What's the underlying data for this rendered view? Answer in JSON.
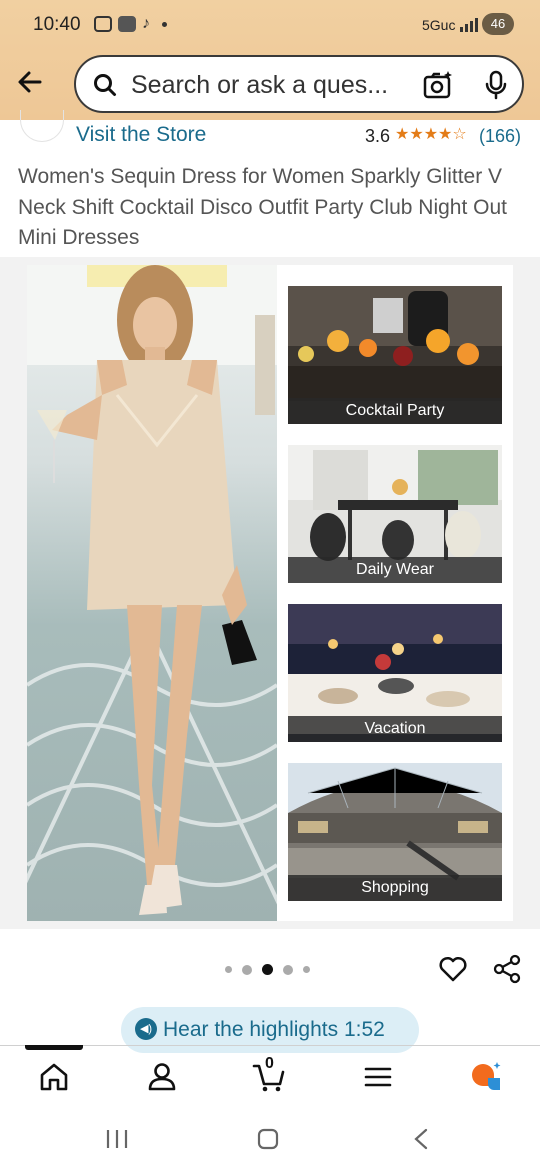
{
  "status_bar": {
    "time": "10:40",
    "network": "5Guc",
    "battery": "46",
    "icons": [
      "screenshot-icon",
      "ring-app-icon",
      "tiktok-icon",
      "notification-dot"
    ]
  },
  "header": {
    "back_icon": "back-arrow-icon",
    "search_placeholder": "Search or ask a ques...",
    "camera_icon": "camera-search-icon",
    "mic_icon": "microphone-icon",
    "background_color": "#f1d0a1"
  },
  "product": {
    "visit_store": "Visit the Store",
    "rating": "3.6",
    "stars": "★★★★☆",
    "star_fraction": 0.72,
    "review_count": "(166)",
    "title": "Women's Sequin Dress for Women Sparkly Glitter V Neck Shift Cocktail Disco Outfit Party Club Night Out Mini Dresses"
  },
  "gallery": {
    "panels": [
      {
        "caption": "Cocktail Party"
      },
      {
        "caption": "Daily Wear"
      },
      {
        "caption": "Vacation"
      },
      {
        "caption": "Shopping"
      }
    ],
    "dots_total": 5,
    "active_dot": 3
  },
  "actions": {
    "wishlist_icon": "heart-icon",
    "share_icon": "share-icon"
  },
  "highlights": {
    "label": "Hear the highlights 1:52"
  },
  "bottom_nav": {
    "items": [
      "home-icon",
      "account-icon",
      "cart-icon",
      "menu-icon",
      "rufus-icon"
    ],
    "cart_count": "0"
  },
  "colors": {
    "link": "#1a6b8c",
    "star": "#e37c18",
    "highlight_bg": "#dceef6"
  }
}
